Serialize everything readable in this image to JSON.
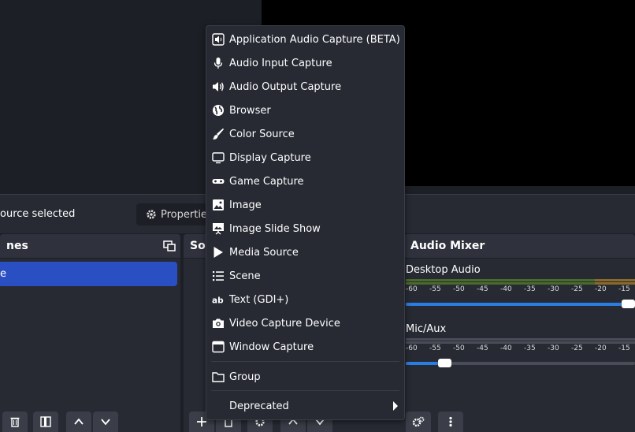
{
  "context_bar": {
    "selection_label": "ource selected",
    "properties_label": "Properties"
  },
  "scenes_dock": {
    "title": "nes",
    "items": [
      "e"
    ]
  },
  "sources_dock": {
    "title": "So"
  },
  "mixer": {
    "title": "Audio Mixer",
    "channels": [
      {
        "name": "Desktop Audio",
        "volume": 0.97,
        "meter_color": "#5a8a3a"
      },
      {
        "name": "Mic/Aux",
        "volume": 0.14,
        "meter_color": "#5a5a5a"
      }
    ],
    "ticks": [
      "-60",
      "-55",
      "-50",
      "-45",
      "-40",
      "-35",
      "-30",
      "-25",
      "-20",
      "-15"
    ]
  },
  "menu": {
    "items": [
      {
        "label": "Application Audio Capture (BETA)",
        "icon": "app-audio-icon"
      },
      {
        "label": "Audio Input Capture",
        "icon": "microphone-icon"
      },
      {
        "label": "Audio Output Capture",
        "icon": "speaker-icon"
      },
      {
        "label": "Browser",
        "icon": "globe-icon"
      },
      {
        "label": "Color Source",
        "icon": "paint-brush-icon"
      },
      {
        "label": "Display Capture",
        "icon": "monitor-icon"
      },
      {
        "label": "Game Capture",
        "icon": "gamepad-icon"
      },
      {
        "label": "Image",
        "icon": "image-icon"
      },
      {
        "label": "Image Slide Show",
        "icon": "slideshow-icon"
      },
      {
        "label": "Media Source",
        "icon": "play-icon"
      },
      {
        "label": "Scene",
        "icon": "list-icon"
      },
      {
        "label": "Text (GDI+)",
        "icon": "text-icon"
      },
      {
        "label": "Video Capture Device",
        "icon": "camera-icon"
      },
      {
        "label": "Window Capture",
        "icon": "window-icon"
      }
    ],
    "group_label": "Group",
    "deprecated_label": "Deprecated"
  },
  "colors": {
    "accent": "#2a4fc2",
    "slider": "#2a7de1",
    "panel": "#272a33",
    "background": "#1d1f26"
  }
}
